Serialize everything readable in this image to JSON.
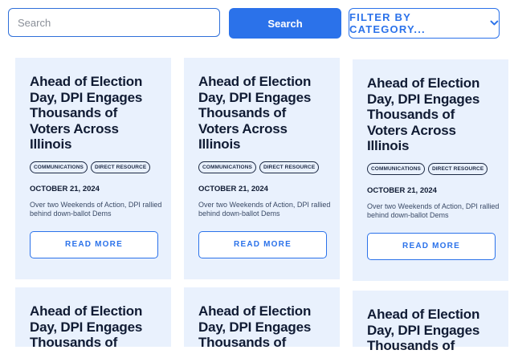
{
  "search": {
    "placeholder": "Search",
    "button_label": "Search"
  },
  "filter": {
    "label": "FILTER BY CATEGORY...",
    "icon": "chevron-down-icon"
  },
  "posts": [
    {
      "title": "Ahead of Election Day, DPI Engages Thousands of Voters Across Illinois",
      "tags": [
        "COMMUNICATIONS",
        "DIRECT RESOURCE"
      ],
      "date": "OCTOBER 21, 2024",
      "excerpt": "Over two Weekends of Action, DPI rallied behind down-ballot Dems",
      "cta": "READ MORE"
    },
    {
      "title": "Ahead of Election Day, DPI Engages Thousands of Voters Across Illinois",
      "tags": [
        "COMMUNICATIONS",
        "DIRECT RESOURCE"
      ],
      "date": "OCTOBER 21, 2024",
      "excerpt": "Over two Weekends of Action, DPI rallied behind down-ballot Dems",
      "cta": "READ MORE"
    },
    {
      "title": "Ahead of Election Day, DPI Engages Thousands of Voters Across Illinois",
      "tags": [
        "COMMUNICATIONS",
        "DIRECT RESOURCE"
      ],
      "date": "OCTOBER 21, 2024",
      "excerpt": "Over two Weekends of Action, DPI rallied behind down-ballot Dems",
      "cta": "READ MORE"
    },
    {
      "title": "Ahead of Election Day, DPI Engages Thousands of",
      "tags": [],
      "date": "",
      "excerpt": "",
      "cta": ""
    },
    {
      "title": "Ahead of Election Day, DPI Engages Thousands of",
      "tags": [],
      "date": "",
      "excerpt": "",
      "cta": ""
    },
    {
      "title": "Ahead of Election Day, DPI Engages Thousands of",
      "tags": [],
      "date": "",
      "excerpt": "",
      "cta": ""
    }
  ],
  "colors": {
    "accent": "#2b72ea",
    "card_bg": "#e9f1fd",
    "text_dark": "#101b33"
  }
}
